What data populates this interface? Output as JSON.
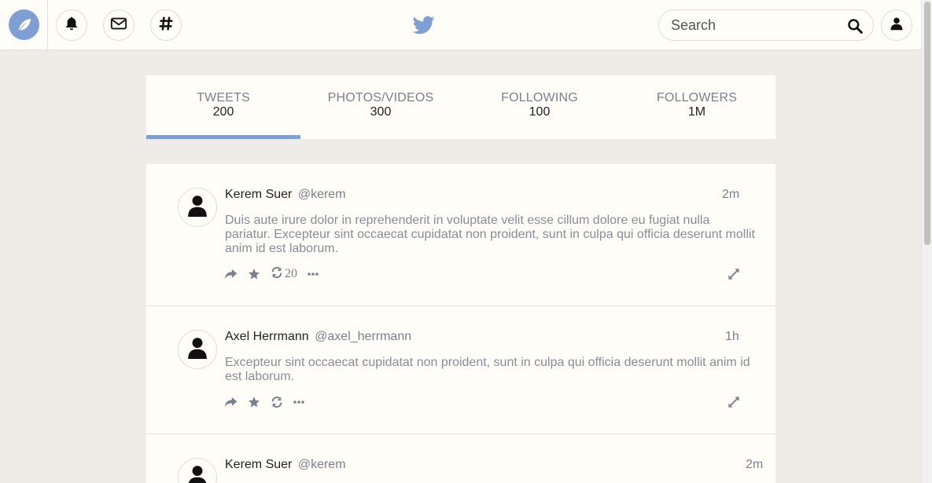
{
  "colors": {
    "accent": "#7f9fd4",
    "icon": "#7a8090",
    "text": "#222222",
    "muted": "#878c98"
  },
  "header": {
    "logo_icon": "leaf-icon",
    "nav_icons": [
      "bell-icon",
      "envelope-icon",
      "hashtag-icon"
    ],
    "center_icon": "twitter-bird-icon",
    "search": {
      "placeholder": "Search",
      "value": "",
      "icon": "search-icon"
    },
    "profile_icon": "user-icon"
  },
  "stats": [
    {
      "label": "TWEETS",
      "value": "200",
      "active": true
    },
    {
      "label": "PHOTOS/VIDEOS",
      "value": "300",
      "active": false
    },
    {
      "label": "FOLLOWING",
      "value": "100",
      "active": false
    },
    {
      "label": "FOLLOWERS",
      "value": "1M",
      "active": false
    }
  ],
  "tweets": [
    {
      "name": "Kerem Suer",
      "handle": "@kerem",
      "time": "2m",
      "text": "Duis aute irure dolor in reprehenderit in voluptate velit esse cillum dolore eu fugiat nulla pariatur. Excepteur sint occaecat cupidatat non proident, sunt in culpa qui officia deserunt mollit anim id est laborum.",
      "retweets": "20"
    },
    {
      "name": "Axel Herrmann",
      "handle": "@axel_herrmann",
      "time": "1h",
      "text": "Excepteur sint occaecat cupidatat non proident, sunt in culpa qui officia deserunt mollit anim id est laborum.",
      "retweets": ""
    },
    {
      "name": "Kerem Suer",
      "handle": "@kerem",
      "time": "2m",
      "text": "",
      "retweets": ""
    }
  ]
}
